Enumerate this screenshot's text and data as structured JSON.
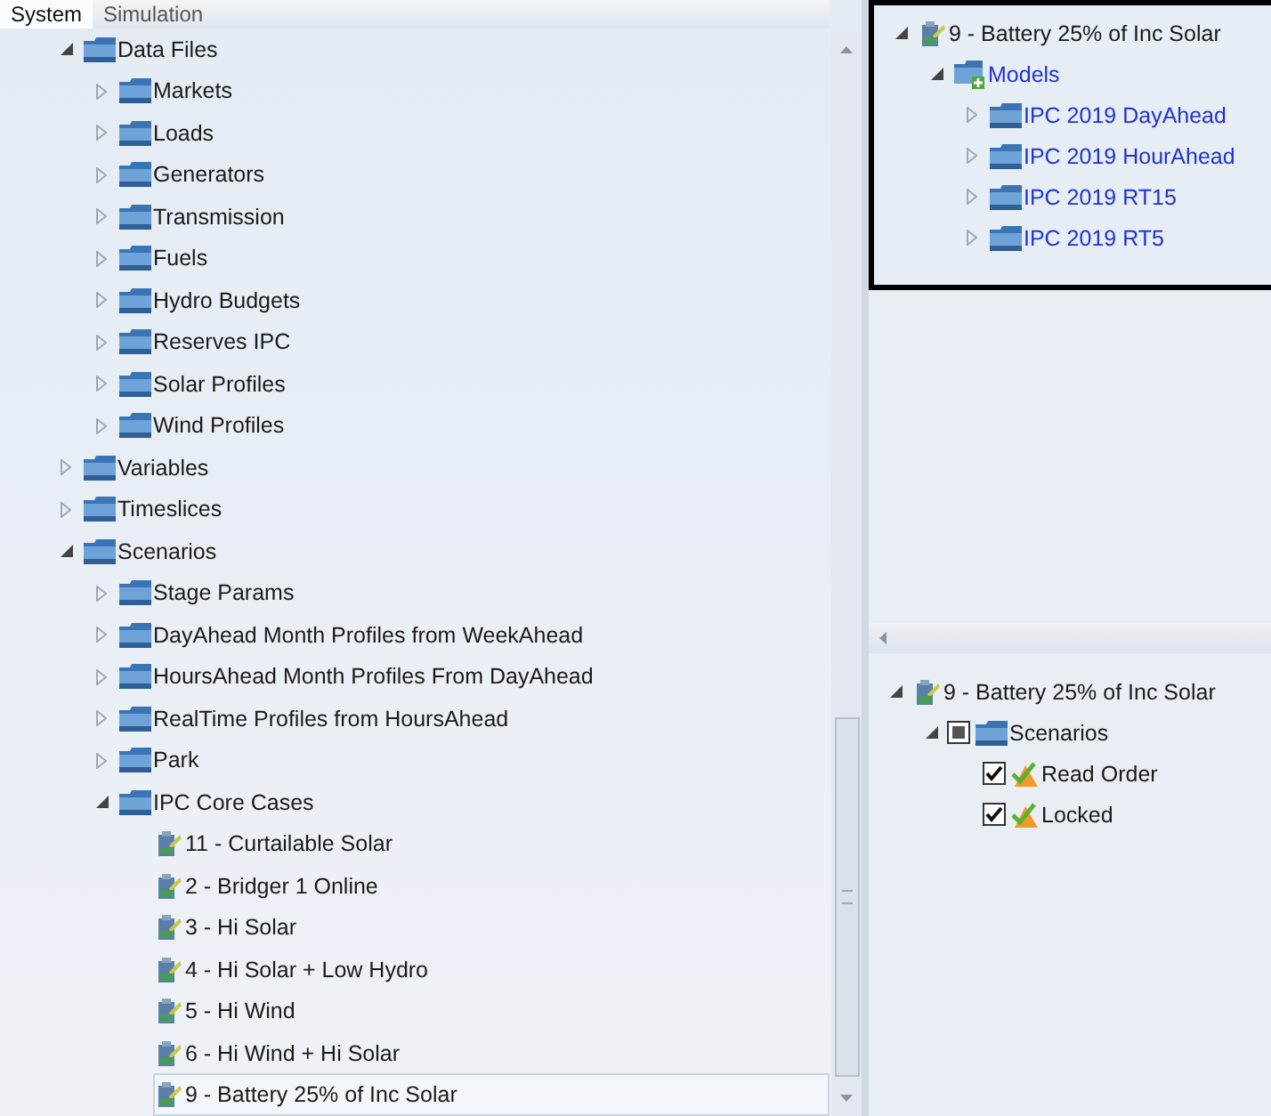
{
  "tabs": [
    {
      "label": "System",
      "selected": true
    },
    {
      "label": "Simulation",
      "selected": false
    }
  ],
  "system_tree": [
    {
      "label": "Data Files",
      "kind": "folder",
      "expanded": true,
      "selected": false,
      "children": [
        {
          "label": "Markets",
          "kind": "folder",
          "expanded": false,
          "selected": false
        },
        {
          "label": "Loads",
          "kind": "folder",
          "expanded": false,
          "selected": false
        },
        {
          "label": "Generators",
          "kind": "folder",
          "expanded": false,
          "selected": false
        },
        {
          "label": "Transmission",
          "kind": "folder",
          "expanded": false,
          "selected": false
        },
        {
          "label": "Fuels",
          "kind": "folder",
          "expanded": false,
          "selected": false
        },
        {
          "label": "Hydro Budgets",
          "kind": "folder",
          "expanded": false,
          "selected": false
        },
        {
          "label": "Reserves IPC",
          "kind": "folder",
          "expanded": false,
          "selected": false
        },
        {
          "label": "Solar Profiles",
          "kind": "folder",
          "expanded": false,
          "selected": false
        },
        {
          "label": "Wind Profiles",
          "kind": "folder",
          "expanded": false,
          "selected": false
        }
      ]
    },
    {
      "label": "Variables",
      "kind": "folder",
      "expanded": false,
      "selected": false
    },
    {
      "label": "Timeslices",
      "kind": "folder",
      "expanded": false,
      "selected": false
    },
    {
      "label": "Scenarios",
      "kind": "folder",
      "expanded": true,
      "selected": false,
      "children": [
        {
          "label": "Stage Params",
          "kind": "folder",
          "expanded": false,
          "selected": false
        },
        {
          "label": "DayAhead Month Profiles from WeekAhead",
          "kind": "folder",
          "expanded": false,
          "selected": false
        },
        {
          "label": "HoursAhead Month Profiles From DayAhead",
          "kind": "folder",
          "expanded": false,
          "selected": false
        },
        {
          "label": "RealTime Profiles from HoursAhead",
          "kind": "folder",
          "expanded": false,
          "selected": false
        },
        {
          "label": "Park",
          "kind": "folder",
          "expanded": false,
          "selected": false
        },
        {
          "label": "IPC Core Cases",
          "kind": "folder",
          "expanded": true,
          "selected": false,
          "children": [
            {
              "label": "11 - Curtailable Solar",
              "kind": "scenario",
              "selected": false
            },
            {
              "label": "2 - Bridger 1 Online",
              "kind": "scenario",
              "selected": false
            },
            {
              "label": "3 - Hi Solar",
              "kind": "scenario",
              "selected": false
            },
            {
              "label": "4 - Hi Solar + Low Hydro",
              "kind": "scenario",
              "selected": false
            },
            {
              "label": "5 - Hi Wind",
              "kind": "scenario",
              "selected": false
            },
            {
              "label": "6 - Hi Wind + Hi Solar",
              "kind": "scenario",
              "selected": false
            },
            {
              "label": "9 - Battery 25% of Inc Solar",
              "kind": "scenario",
              "selected": true
            }
          ]
        }
      ]
    }
  ],
  "memberships_tree": [
    {
      "label": "9 - Battery 25% of Inc Solar",
      "kind": "scenario",
      "expanded": true,
      "children": [
        {
          "label": "Models",
          "kind": "models",
          "expanded": true,
          "children": [
            {
              "label": "IPC 2019 DayAhead",
              "kind": "model",
              "expanded": false
            },
            {
              "label": "IPC 2019 HourAhead",
              "kind": "model",
              "expanded": false
            },
            {
              "label": "IPC 2019 RT15",
              "kind": "model",
              "expanded": false
            },
            {
              "label": "IPC 2019 RT5",
              "kind": "model",
              "expanded": false
            }
          ]
        }
      ]
    }
  ],
  "properties_tree": [
    {
      "label": "9 - Battery 25% of Inc Solar",
      "kind": "scenario",
      "expanded": true,
      "children": [
        {
          "label": "Scenarios",
          "kind": "category",
          "expanded": true,
          "checked": false,
          "partial": true,
          "children": [
            {
              "label": "Read Order",
              "kind": "property",
              "checked": true
            },
            {
              "label": "Locked",
              "kind": "property",
              "checked": true
            }
          ]
        }
      ]
    }
  ]
}
